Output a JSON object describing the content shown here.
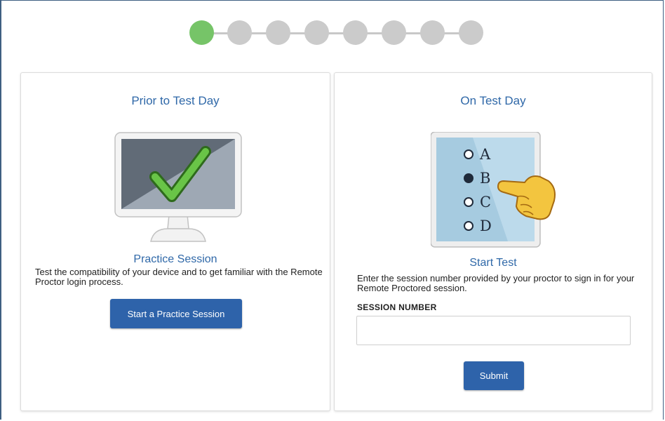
{
  "stepper": {
    "total_steps": 8,
    "current_step": 1,
    "colors": {
      "active": "#76c468",
      "inactive": "#cbcbcb"
    }
  },
  "left_card": {
    "title": "Prior to Test Day",
    "illustration_icon": "monitor-checkmark-icon",
    "subtitle": "Practice Session",
    "description": "Test the compatibility of your device and to get familiar with the Remote Proctor login process.",
    "button_label": "Start a Practice Session"
  },
  "right_card": {
    "title": "On Test Day",
    "illustration_icon": "tablet-multiple-choice-icon",
    "choices": [
      "A",
      "B",
      "C",
      "D"
    ],
    "selected_choice": "B",
    "subtitle": "Start Test",
    "description": "Enter the session number provided by your proctor to sign in for your Remote Proctored session.",
    "field_label": "SESSION NUMBER",
    "field_value": "",
    "field_placeholder": "",
    "submit_label": "Submit"
  },
  "colors": {
    "accent": "#2f68a8",
    "button": "#2e63aa",
    "frame": "#3e5f82"
  }
}
